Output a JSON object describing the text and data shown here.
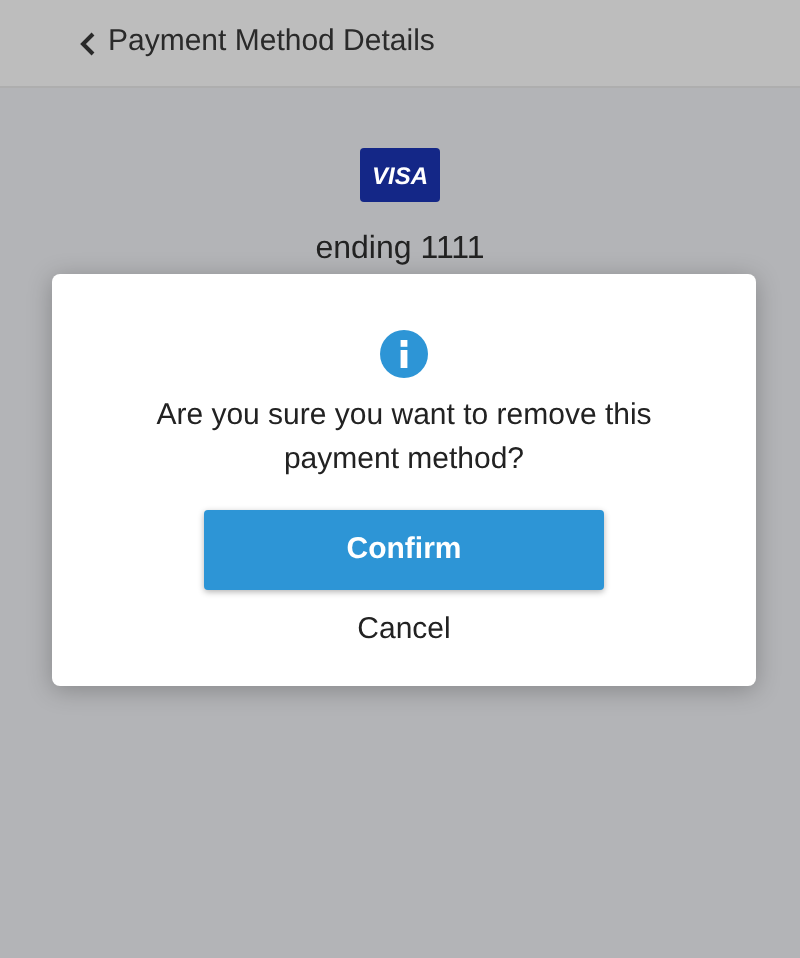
{
  "header": {
    "title": "Payment Method Details"
  },
  "card": {
    "brand": "VISA",
    "ending": "ending 1111"
  },
  "dialog": {
    "message": "Are you sure you want to remove this payment method?",
    "buttons": [
      {
        "kind": "primary",
        "label": "Confirm"
      },
      {
        "kind": "link",
        "label": "Cancel"
      }
    ]
  }
}
